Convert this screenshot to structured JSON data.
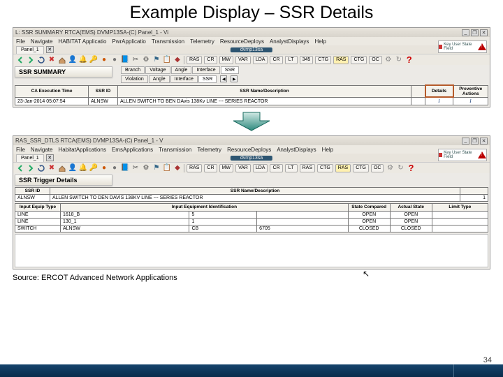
{
  "title": "Example Display – SSR Details",
  "source": "Source: ERCOT Advanced Network Applications",
  "page_number": "34",
  "top": {
    "window_title": "L: SSR SUMMARY RTCA(EMS)   DVMP13SA-(C)    Panel_1 - Vi",
    "url": "dvmp13sa",
    "menus": [
      "File",
      "Navigate",
      "HABITAT Applicatio",
      "PwrApplicatio",
      "Transmission",
      "Telemetry",
      "ResourceDeploys",
      "AnalystDisplays",
      "Help"
    ],
    "tabs": [
      "Branch",
      "Voltage",
      "Angle",
      "Interface",
      "SSR"
    ],
    "sub_tabs": [
      "Violation",
      "Angle",
      "Interface",
      "SSR"
    ],
    "buttons": [
      "RAS",
      "CR",
      "MW",
      "VAR",
      "LDA",
      "CR",
      "LT",
      "345",
      "CTG",
      "RAS",
      "CTG",
      "OC"
    ],
    "section": "SSR SUMMARY",
    "grid": {
      "headers": [
        "CA Execution Time",
        "SSR\nID",
        "SSR\nName/Description",
        "",
        "Details",
        "Preventive\nActions"
      ],
      "row": [
        "23-Jan-2014 05:07:54",
        "ALNSW",
        "ALLEN SWITCH TO BEN DAvis 138Kv LINE --- SERIES REACTOR",
        "",
        "i",
        "i"
      ]
    },
    "keybox": "Key User State Field"
  },
  "bottom": {
    "window_title": "RAS_SSR_DTLS RTCA(EMS)   DVMP13SA-(C)    Panel_1 - V",
    "url": "dvmp13sa",
    "menus": [
      "File",
      "Navigate",
      "HabitatApplications",
      "EmsApplications",
      "Transmission",
      "Telemetry",
      "ResourceDeploys",
      "AnalystDisplays",
      "Help"
    ],
    "buttons": [
      "RAS",
      "CR",
      "MW",
      "VAR",
      "LDA",
      "CR",
      "LT",
      "RAS",
      "CTG",
      "RAS",
      "CTG",
      "OC"
    ],
    "section": "SSR Trigger Details",
    "master": {
      "headers": [
        "SSR\nID",
        "SSR\nName/Description",
        ""
      ],
      "row": [
        "ALNSW",
        "ALLEN SWITCH TO DEN DAVIS 138KV LINE --- SERIES REACTOR",
        "1"
      ]
    },
    "detail": {
      "headers": [
        "Input Equip\nType",
        "Input Equipment Identification",
        "",
        "",
        "State\nCompared",
        "Actual\nState",
        "Limit\nType"
      ],
      "rows": [
        [
          "LINE",
          "1618_B",
          "5",
          "",
          "OPEN",
          "OPEN",
          ""
        ],
        [
          "LINE",
          "130_1",
          "1",
          "",
          "OPEN",
          "OPEN",
          ""
        ],
        [
          "SWITCH",
          "ALNSW",
          "CB",
          "6705",
          "CLOSED",
          "CLOSED",
          ""
        ]
      ]
    },
    "keybox": "Key User State Field"
  }
}
